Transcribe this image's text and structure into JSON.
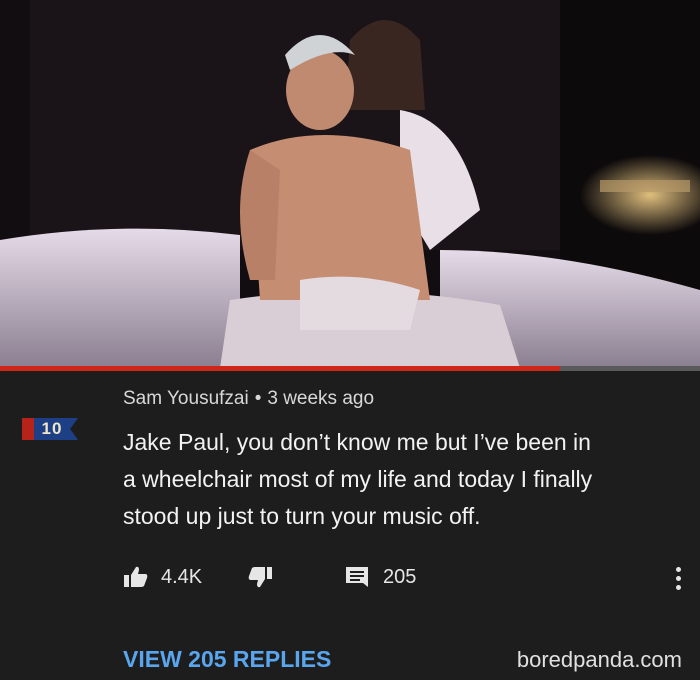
{
  "video": {
    "progress": 0.8
  },
  "comment": {
    "badge": "10",
    "author": "Sam Yousufzai",
    "separator": "•",
    "time": "3 weeks ago",
    "lines": [
      "Jake Paul, you don’t know me but I’ve been in",
      "a wheelchair most of my life and today I finally",
      "stood up just to turn your music off."
    ],
    "likes": "4.4K",
    "reply_count": "205",
    "view_replies": "VIEW 205 REPLIES"
  },
  "icons": [
    "thumbs-up-icon",
    "thumbs-down-icon",
    "comment-icon",
    "more-vert-icon"
  ],
  "colors": {
    "link": "#5aa6ee",
    "progress": "#d0261a",
    "background": "#1d1d1d"
  },
  "watermark": "boredpanda.com"
}
